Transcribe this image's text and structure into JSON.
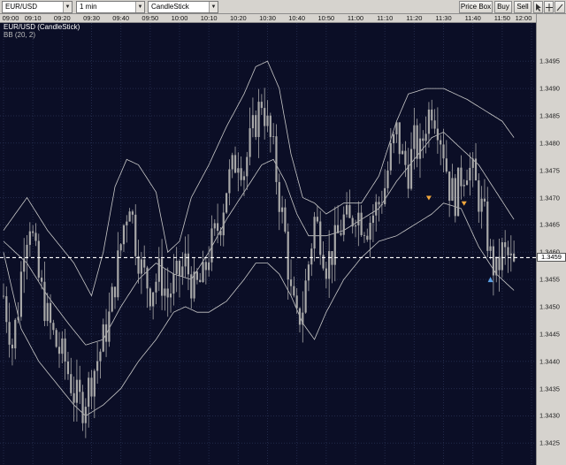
{
  "toolbar": {
    "symbol": "EUR/USD",
    "timeframe": "1 min",
    "chart_type": "CandleStick",
    "price_box_label": "Price Box",
    "buy_label": "Buy",
    "sell_label": "Sell",
    "tool_icons": [
      "pointer-icon",
      "crosshair-icon",
      "trend-line-icon"
    ]
  },
  "legend": {
    "instrument": "EUR/USD (CandleStick)",
    "indicator": "BB (20, 2)"
  },
  "colors": {
    "background": "#0b0e26",
    "grid": "#232a4a",
    "candle": "#a8a8a8",
    "band": "#c8c8c8",
    "sell_marker": "#f2a73c",
    "buy_marker": "#5aa0e6",
    "current_price_line": "#ffffff"
  },
  "current_price": "1.3459",
  "chart_data": {
    "type": "candlestick",
    "symbol": "EUR/USD",
    "interval": "1 min",
    "x_ticks": [
      "09:00",
      "09:10",
      "09:20",
      "09:30",
      "09:40",
      "09:50",
      "10:00",
      "10:10",
      "10:20",
      "10:30",
      "10:40",
      "10:50",
      "11:00",
      "11:10",
      "11:20",
      "11:30",
      "11:40",
      "11:50",
      "12:00"
    ],
    "y_ticks": [
      "1.3495",
      "1.3490",
      "1.3485",
      "1.3480",
      "1.3475",
      "1.3470",
      "1.3465",
      "1.3460",
      "1.3455",
      "1.3450",
      "1.3445",
      "1.3440",
      "1.3435",
      "1.3430",
      "1.3425"
    ],
    "y_range": [
      1.3421,
      1.3502
    ],
    "time_range_minutes": [
      -1.2,
      181.5
    ],
    "grid": true,
    "close_path": [
      [
        0,
        1.3452
      ],
      [
        3,
        1.3443
      ],
      [
        5,
        1.345
      ],
      [
        7,
        1.3462
      ],
      [
        9,
        1.3466
      ],
      [
        12,
        1.3455
      ],
      [
        15,
        1.3448
      ],
      [
        18,
        1.3443
      ],
      [
        21,
        1.344
      ],
      [
        24,
        1.3434
      ],
      [
        27,
        1.3432
      ],
      [
        30,
        1.3437
      ],
      [
        33,
        1.3442
      ],
      [
        36,
        1.3448
      ],
      [
        39,
        1.3458
      ],
      [
        41,
        1.3465
      ],
      [
        43,
        1.347
      ],
      [
        45,
        1.3462
      ],
      [
        47,
        1.3457
      ],
      [
        50,
        1.3453
      ],
      [
        53,
        1.3456
      ],
      [
        56,
        1.3452
      ],
      [
        59,
        1.3455
      ],
      [
        62,
        1.3458
      ],
      [
        65,
        1.3453
      ],
      [
        68,
        1.3455
      ],
      [
        70,
        1.346
      ],
      [
        72,
        1.3463
      ],
      [
        74,
        1.3466
      ],
      [
        76,
        1.3472
      ],
      [
        78,
        1.3475
      ],
      [
        80,
        1.3478
      ],
      [
        82,
        1.3475
      ],
      [
        84,
        1.348
      ],
      [
        86,
        1.3484
      ],
      [
        88,
        1.3488
      ],
      [
        90,
        1.3483
      ],
      [
        92,
        1.3478
      ],
      [
        94,
        1.347
      ],
      [
        96,
        1.3463
      ],
      [
        98,
        1.3452
      ],
      [
        100,
        1.3447
      ],
      [
        102,
        1.345
      ],
      [
        104,
        1.3458
      ],
      [
        106,
        1.3466
      ],
      [
        108,
        1.3463
      ],
      [
        110,
        1.3458
      ],
      [
        112,
        1.346
      ],
      [
        114,
        1.3463
      ],
      [
        116,
        1.3466
      ],
      [
        118,
        1.3465
      ],
      [
        120,
        1.3468
      ],
      [
        122,
        1.3466
      ],
      [
        124,
        1.3465
      ],
      [
        126,
        1.3467
      ],
      [
        128,
        1.3469
      ],
      [
        130,
        1.3472
      ],
      [
        132,
        1.3478
      ],
      [
        134,
        1.3482
      ],
      [
        136,
        1.3477
      ],
      [
        138,
        1.3475
      ],
      [
        140,
        1.348
      ],
      [
        142,
        1.3478
      ],
      [
        144,
        1.3484
      ],
      [
        146,
        1.3487
      ],
      [
        148,
        1.3484
      ],
      [
        150,
        1.3479
      ],
      [
        152,
        1.3472
      ],
      [
        154,
        1.347
      ],
      [
        156,
        1.3474
      ],
      [
        158,
        1.3476
      ],
      [
        160,
        1.3474
      ],
      [
        162,
        1.347
      ],
      [
        164,
        1.3466
      ],
      [
        166,
        1.3459
      ],
      [
        168,
        1.3456
      ],
      [
        170,
        1.346
      ],
      [
        172,
        1.3459
      ],
      [
        174,
        1.3457
      ]
    ],
    "bollinger": {
      "period": 20,
      "deviations": 2,
      "upper": [
        [
          0,
          1.3464
        ],
        [
          8,
          1.347
        ],
        [
          15,
          1.3464
        ],
        [
          24,
          1.3458
        ],
        [
          30,
          1.3452
        ],
        [
          34,
          1.346
        ],
        [
          38,
          1.3472
        ],
        [
          42,
          1.3477
        ],
        [
          46,
          1.3476
        ],
        [
          52,
          1.3471
        ],
        [
          56,
          1.346
        ],
        [
          60,
          1.3462
        ],
        [
          64,
          1.347
        ],
        [
          70,
          1.3476
        ],
        [
          76,
          1.3483
        ],
        [
          82,
          1.3489
        ],
        [
          86,
          1.3494
        ],
        [
          90,
          1.3495
        ],
        [
          94,
          1.349
        ],
        [
          98,
          1.3478
        ],
        [
          102,
          1.347
        ],
        [
          106,
          1.3469
        ],
        [
          110,
          1.3467
        ],
        [
          116,
          1.3469
        ],
        [
          122,
          1.3469
        ],
        [
          128,
          1.3474
        ],
        [
          134,
          1.3484
        ],
        [
          138,
          1.3489
        ],
        [
          144,
          1.349
        ],
        [
          150,
          1.349
        ],
        [
          158,
          1.3488
        ],
        [
          164,
          1.3486
        ],
        [
          170,
          1.3484
        ],
        [
          174,
          1.3481
        ]
      ],
      "middle": [
        [
          0,
          1.3462
        ],
        [
          8,
          1.3458
        ],
        [
          15,
          1.3452
        ],
        [
          22,
          1.3447
        ],
        [
          28,
          1.3443
        ],
        [
          34,
          1.3444
        ],
        [
          40,
          1.345
        ],
        [
          46,
          1.3455
        ],
        [
          52,
          1.3458
        ],
        [
          58,
          1.3456
        ],
        [
          64,
          1.3455
        ],
        [
          70,
          1.346
        ],
        [
          76,
          1.3466
        ],
        [
          82,
          1.3471
        ],
        [
          88,
          1.3476
        ],
        [
          92,
          1.3477
        ],
        [
          96,
          1.3473
        ],
        [
          100,
          1.3467
        ],
        [
          104,
          1.3463
        ],
        [
          110,
          1.3463
        ],
        [
          116,
          1.3464
        ],
        [
          122,
          1.3466
        ],
        [
          128,
          1.3468
        ],
        [
          134,
          1.3473
        ],
        [
          140,
          1.3477
        ],
        [
          146,
          1.3481
        ],
        [
          150,
          1.3482
        ],
        [
          156,
          1.3479
        ],
        [
          162,
          1.3476
        ],
        [
          168,
          1.3471
        ],
        [
          174,
          1.3466
        ]
      ],
      "lower": [
        [
          0,
          1.346
        ],
        [
          6,
          1.3446
        ],
        [
          12,
          1.344
        ],
        [
          18,
          1.3436
        ],
        [
          24,
          1.3432
        ],
        [
          28,
          1.343
        ],
        [
          34,
          1.3432
        ],
        [
          40,
          1.3435
        ],
        [
          46,
          1.344
        ],
        [
          52,
          1.3444
        ],
        [
          58,
          1.3449
        ],
        [
          62,
          1.345
        ],
        [
          66,
          1.3449
        ],
        [
          70,
          1.3449
        ],
        [
          76,
          1.3451
        ],
        [
          82,
          1.3455
        ],
        [
          86,
          1.3458
        ],
        [
          90,
          1.3458
        ],
        [
          94,
          1.3456
        ],
        [
          98,
          1.3452
        ],
        [
          102,
          1.3447
        ],
        [
          106,
          1.3444
        ],
        [
          110,
          1.3449
        ],
        [
          116,
          1.3455
        ],
        [
          122,
          1.3459
        ],
        [
          128,
          1.3462
        ],
        [
          134,
          1.3463
        ],
        [
          140,
          1.3465
        ],
        [
          146,
          1.3467
        ],
        [
          150,
          1.3469
        ],
        [
          156,
          1.3468
        ],
        [
          162,
          1.3461
        ],
        [
          168,
          1.3456
        ],
        [
          174,
          1.3453
        ]
      ]
    },
    "sell_signals": [
      [
        145,
        1.347
      ],
      [
        157,
        1.3469
      ]
    ],
    "buy_signals": [
      [
        166,
        1.3455
      ]
    ]
  }
}
